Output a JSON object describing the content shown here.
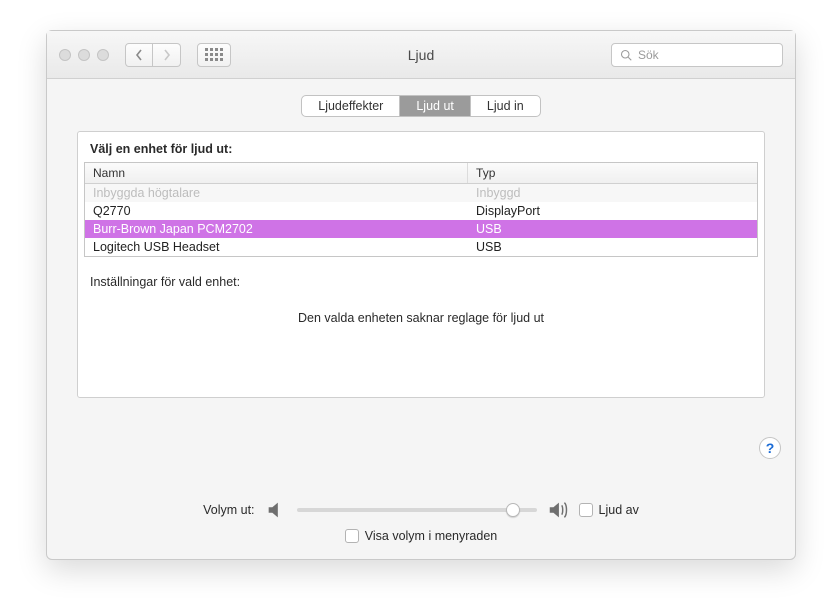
{
  "window": {
    "title": "Ljud"
  },
  "search": {
    "placeholder": "Sök"
  },
  "tabs": [
    {
      "label": "Ljudeffekter",
      "active": false
    },
    {
      "label": "Ljud ut",
      "active": true
    },
    {
      "label": "Ljud in",
      "active": false
    }
  ],
  "section": {
    "heading": "Välj en enhet för ljud ut:",
    "columns": {
      "name": "Namn",
      "type": "Typ"
    },
    "rows": [
      {
        "name": "Inbyggda högtalare",
        "type": "Inbyggd",
        "dim": true,
        "selected": false
      },
      {
        "name": "Q2770",
        "type": "DisplayPort",
        "dim": false,
        "selected": false
      },
      {
        "name": "Burr-Brown Japan PCM2702",
        "type": "USB",
        "dim": false,
        "selected": true
      },
      {
        "name": "Logitech USB Headset",
        "type": "USB",
        "dim": false,
        "selected": false
      }
    ],
    "settings_label": "Inställningar för vald enhet:",
    "no_controls_msg": "Den valda enheten saknar reglage för ljud ut"
  },
  "footer": {
    "volume_label": "Volym ut:",
    "mute_label": "Ljud av",
    "menubar_label": "Visa volym i menyraden",
    "volume_pct": 90
  }
}
